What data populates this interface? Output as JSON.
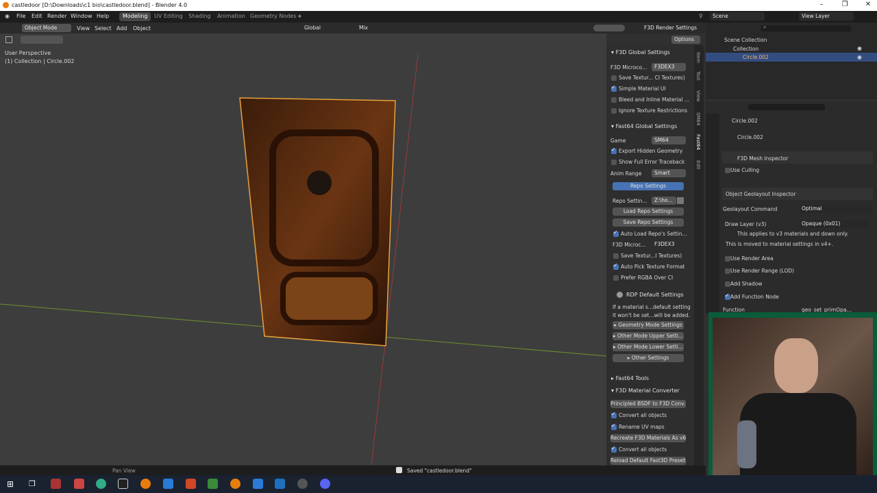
{
  "window": {
    "title": "castledoor [D:\\Downloads\\c1 bio\\castledoor.blend] - Blender 4.0"
  },
  "menu": {
    "items": [
      "File",
      "Edit",
      "Render",
      "Window",
      "Help"
    ],
    "workspaces": [
      "Modeling",
      "UV Editing",
      "Shading",
      "Animation",
      "Geometry Nodes"
    ],
    "add_workspace": "+",
    "scene": "Scene",
    "view_layer": "View Layer"
  },
  "viewport_header": {
    "mode": "Object Mode",
    "menus": [
      "View",
      "Select",
      "Add",
      "Object"
    ],
    "orientation": "Global",
    "snap_mode": "Mix",
    "render_settings": "F3D Render Settings",
    "options": "Options"
  },
  "viewport": {
    "perspective": "User Perspective",
    "collection": "(1) Collection | Circle.002"
  },
  "npanel": {
    "f3d_global": {
      "header": "F3D Global Settings",
      "microcode_label": "F3D Microco...",
      "microcode_value": "F3DEX3",
      "opts": [
        {
          "label": "Save Textur... CI Textures)",
          "on": false
        },
        {
          "label": "Simple Material UI",
          "on": true
        },
        {
          "label": "Bleed and Inline Material ...",
          "on": false
        },
        {
          "label": "Ignore Texture Restrictions",
          "on": false
        }
      ]
    },
    "fast64_global": {
      "header": "Fast64 Global Settings",
      "game_label": "Game",
      "game_value": "SM64",
      "opts": [
        {
          "label": "Export Hidden Geometry",
          "on": true
        },
        {
          "label": "Show Full Error Traceback",
          "on": false
        }
      ],
      "anim_label": "Anim Range",
      "anim_value": "Smart"
    },
    "repo": {
      "header": "Repo Settings",
      "path_label": "Repo Settin...",
      "path_value": "Z:\\ho...",
      "load": "Load Repo Settings",
      "save": "Save Repo Settings",
      "auto_load": "Auto Load Repo's Settin...",
      "micro_label": "F3D Microc...",
      "micro_value": "F3DEX3",
      "opts": [
        {
          "label": "Save Textur...I Textures)",
          "on": false
        },
        {
          "label": "Auto Pick Texture Format",
          "on": true
        },
        {
          "label": "Prefer RGBA Over CI",
          "on": false
        }
      ]
    },
    "rdp": {
      "header": "RDP Default Settings",
      "note1": "If a material s...default setting",
      "note2": "it won't be set...will be added.",
      "subs": [
        "Geometry Mode Settings",
        "Other Mode Upper Setti...",
        "Other Mode Lower Setti...",
        "Other Settings"
      ]
    },
    "tools": "Fast64 Tools",
    "converter": {
      "header": "F3D Material Converter",
      "principled": "Principled BSDF to F3D Conv...",
      "convert1": "Convert all objects",
      "rename_uv": "Rename UV maps",
      "recreate": "Recreate F3D Materials As v6",
      "convert2": "Convert all objects",
      "reload": "Reload Default Fast3D Presets"
    },
    "tabs": [
      "Item",
      "Tool",
      "View",
      "SM64",
      "Fast64",
      "Edit"
    ]
  },
  "outliner": {
    "root": "Scene Collection",
    "collection": "Collection",
    "object": "Circle.002"
  },
  "properties": {
    "object": "Circle.002",
    "mesh": "Circle.002",
    "inspector": "F3D Mesh Inspector",
    "use_culling": "Use Culling",
    "geo_header": "Object Geolayout Inspector",
    "geo_cmd_label": "Geolayout Command",
    "geo_cmd_value": "Optimal",
    "draw_layer_label": "Draw Layer (v3)",
    "draw_layer_value": "Opaque (0x01)",
    "note1": "This applies to v3 materials and down only.",
    "note2": "This is moved to material settings in v4+.",
    "use_render_area": "Use Render Area",
    "use_render_range": "Use Render Range (LOD)",
    "add_shadow": "Add Shadow",
    "add_function_node": "Add Function Node",
    "function_label": "Function",
    "function_value": "geo_set_primOpa..."
  },
  "status": {
    "pan": "Pan View",
    "saved": "Saved \"castledoor.blend\""
  },
  "colors": {
    "accent": "#4772b3",
    "selection": "#e8a33d",
    "webcam_border": "#0a5c3a"
  }
}
